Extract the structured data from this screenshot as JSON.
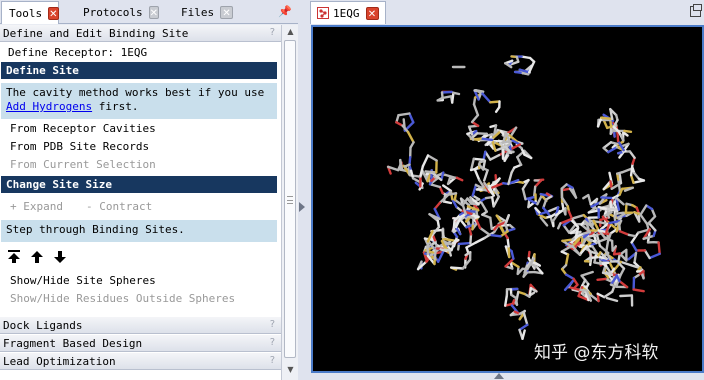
{
  "left_tabs": [
    {
      "label": "Tools",
      "active": true
    },
    {
      "label": "Protocols",
      "active": false
    },
    {
      "label": "Files",
      "active": false
    }
  ],
  "section_title": "Define and Edit Binding Site",
  "define_receptor": "Define Receptor: 1EQG",
  "define_site": {
    "header": "Define Site",
    "info_before": "The cavity method works best if you use ",
    "info_link": "Add Hydrogens",
    "info_after": " first.",
    "options": [
      "From Receptor Cavities",
      "From PDB Site Records",
      "From Current Selection"
    ]
  },
  "change_size": {
    "header": "Change Site Size",
    "expand": "+ Expand",
    "contract": "- Contract"
  },
  "step_through": "Step through Binding Sites.",
  "show_hide_spheres": "Show/Hide Site Spheres",
  "show_hide_residues": "Show/Hide Residues Outside Spheres",
  "collapsed_sections": [
    "Dock Ligands",
    "Fragment Based Design",
    "Lead Optimization"
  ],
  "help_glyph": "?",
  "viewer_tab": "1EQG",
  "watermark": "知乎 @东方科软",
  "colors": {
    "header_blue": "#17375f",
    "info_bg": "#c9dfec",
    "viewer_bg": "#000000",
    "tab_close_red": "#d9442d"
  }
}
